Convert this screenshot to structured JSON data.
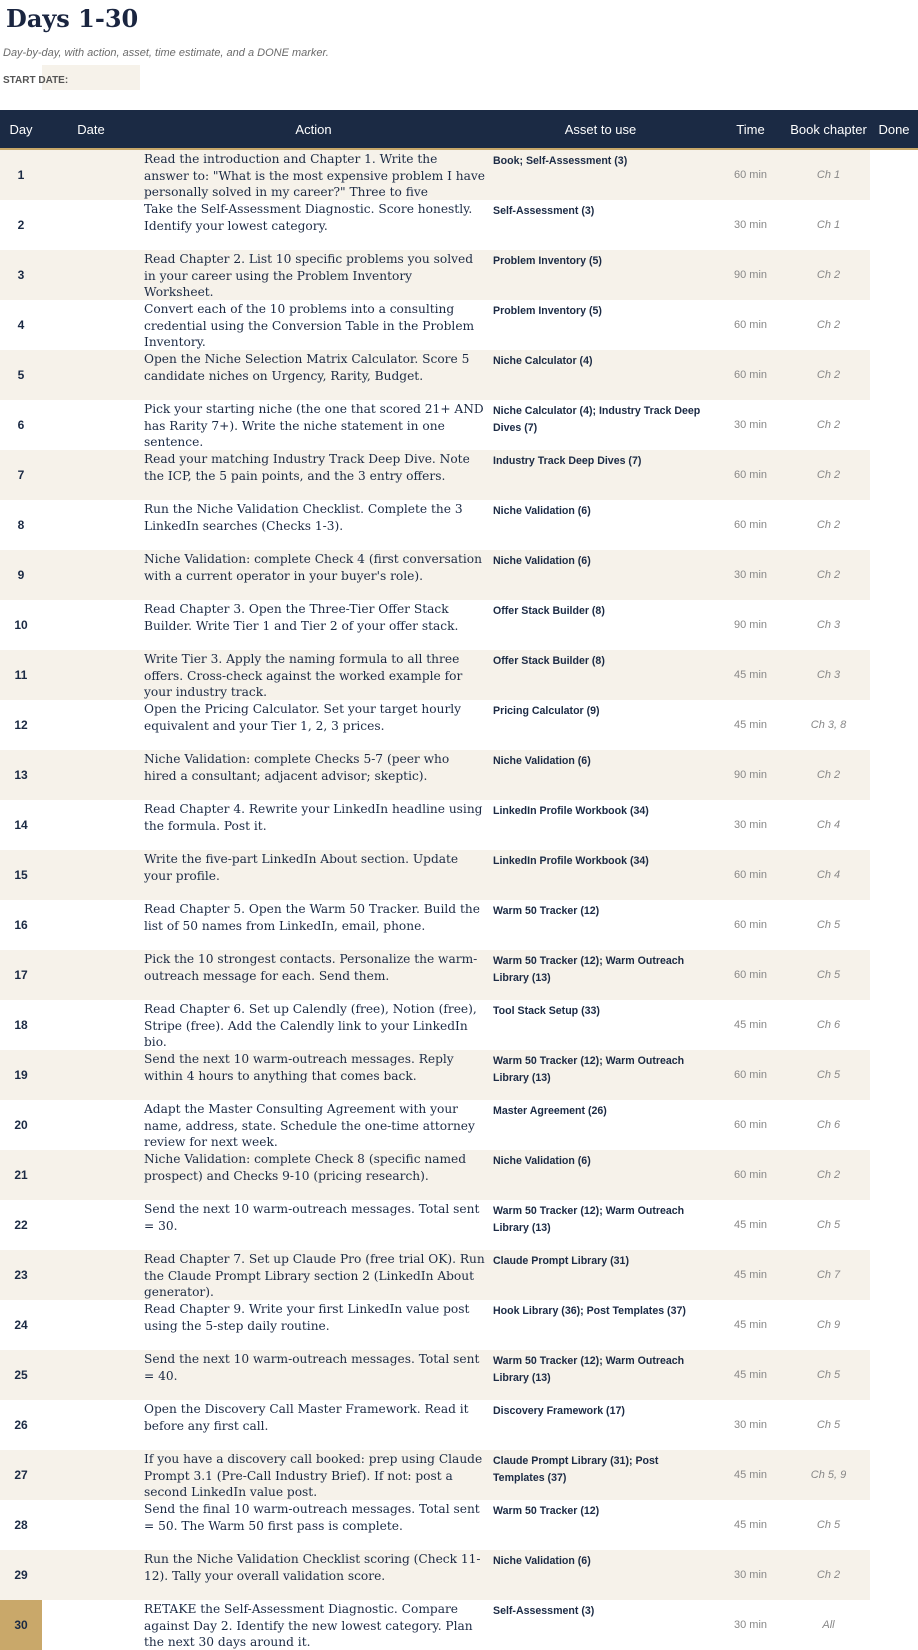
{
  "title": "Days 1-30",
  "subtitle": "Day-by-day, with action, asset, time estimate, and a DONE marker.",
  "start_date_label": "START DATE:",
  "start_date_value": "",
  "columns": [
    "Day",
    "Date",
    "Action",
    "Asset to use",
    "Time",
    "Book chapter",
    "Done"
  ],
  "highlight_color": "#c9a86a",
  "header_color": "#1b2a44",
  "rows": [
    {
      "day": "1",
      "action": "Read the introduction and Chapter 1. Write the answer to: \"What is the most expensive problem I have personally solved in my career?\" Three to five",
      "asset": "Book; Self-Assessment (3)",
      "time": "60 min",
      "chapter": "Ch 1"
    },
    {
      "day": "2",
      "action": "Take the Self-Assessment Diagnostic. Score honestly. Identify your lowest category.",
      "asset": "Self-Assessment (3)",
      "time": "30 min",
      "chapter": "Ch 1"
    },
    {
      "day": "3",
      "action": "Read Chapter 2. List 10 specific problems you solved in your career using the Problem Inventory Worksheet.",
      "asset": "Problem Inventory (5)",
      "time": "90 min",
      "chapter": "Ch 2"
    },
    {
      "day": "4",
      "action": "Convert each of the 10 problems into a consulting credential using the Conversion Table in the Problem Inventory.",
      "asset": "Problem Inventory (5)",
      "time": "60 min",
      "chapter": "Ch 2"
    },
    {
      "day": "5",
      "action": "Open the Niche Selection Matrix Calculator. Score 5 candidate niches on Urgency, Rarity, Budget.",
      "asset": "Niche Calculator (4)",
      "time": "60 min",
      "chapter": "Ch 2"
    },
    {
      "day": "6",
      "action": "Pick your starting niche (the one that scored 21+ AND has Rarity 7+). Write the niche statement in one sentence.",
      "asset": "Niche Calculator (4); Industry Track Deep Dives (7)",
      "time": "30 min",
      "chapter": "Ch 2"
    },
    {
      "day": "7",
      "action": "Read your matching Industry Track Deep Dive. Note the ICP, the 5 pain points, and the 3 entry offers.",
      "asset": "Industry Track Deep Dives (7)",
      "time": "60 min",
      "chapter": "Ch 2"
    },
    {
      "day": "8",
      "action": "Run the Niche Validation Checklist. Complete the 3 LinkedIn searches (Checks 1-3).",
      "asset": "Niche Validation (6)",
      "time": "60 min",
      "chapter": "Ch 2"
    },
    {
      "day": "9",
      "action": "Niche Validation: complete Check 4 (first conversation with a current operator in your buyer's role).",
      "asset": "Niche Validation (6)",
      "time": "30 min",
      "chapter": "Ch 2"
    },
    {
      "day": "10",
      "action": "Read Chapter 3. Open the Three-Tier Offer Stack Builder. Write Tier 1 and Tier 2 of your offer stack.",
      "asset": "Offer Stack Builder (8)",
      "time": "90 min",
      "chapter": "Ch 3"
    },
    {
      "day": "11",
      "action": "Write Tier 3. Apply the naming formula to all three offers. Cross-check against the worked example for your industry track.",
      "asset": "Offer Stack Builder (8)",
      "time": "45 min",
      "chapter": "Ch 3"
    },
    {
      "day": "12",
      "action": "Open the Pricing Calculator. Set your target hourly equivalent and your Tier 1, 2, 3 prices.",
      "asset": "Pricing Calculator (9)",
      "time": "45 min",
      "chapter": "Ch 3, 8"
    },
    {
      "day": "13",
      "action": "Niche Validation: complete Checks 5-7 (peer who hired a consultant; adjacent advisor; skeptic).",
      "asset": "Niche Validation (6)",
      "time": "90 min",
      "chapter": "Ch 2"
    },
    {
      "day": "14",
      "action": "Read Chapter 4. Rewrite your LinkedIn headline using the formula. Post it.",
      "asset": "LinkedIn Profile Workbook (34)",
      "time": "30 min",
      "chapter": "Ch 4"
    },
    {
      "day": "15",
      "action": "Write the five-part LinkedIn About section. Update your profile.",
      "asset": "LinkedIn Profile Workbook (34)",
      "time": "60 min",
      "chapter": "Ch 4"
    },
    {
      "day": "16",
      "action": "Read Chapter 5. Open the Warm 50 Tracker. Build the list of 50 names from LinkedIn, email, phone.",
      "asset": "Warm 50 Tracker (12)",
      "time": "60 min",
      "chapter": "Ch 5"
    },
    {
      "day": "17",
      "action": "Pick the 10 strongest contacts. Personalize the warm-outreach message for each. Send them.",
      "asset": "Warm 50 Tracker (12); Warm Outreach Library (13)",
      "time": "60 min",
      "chapter": "Ch 5"
    },
    {
      "day": "18",
      "action": "Read Chapter 6. Set up Calendly (free), Notion (free), Stripe (free). Add the Calendly link to your LinkedIn bio.",
      "asset": "Tool Stack Setup (33)",
      "time": "45 min",
      "chapter": "Ch 6"
    },
    {
      "day": "19",
      "action": "Send the next 10 warm-outreach messages. Reply within 4 hours to anything that comes back.",
      "asset": "Warm 50 Tracker (12); Warm Outreach Library (13)",
      "time": "60 min",
      "chapter": "Ch 5"
    },
    {
      "day": "20",
      "action": "Adapt the Master Consulting Agreement with your name, address, state. Schedule the one-time attorney review for next week.",
      "asset": "Master Agreement (26)",
      "time": "60 min",
      "chapter": "Ch 6"
    },
    {
      "day": "21",
      "action": "Niche Validation: complete Check 8 (specific named prospect) and Checks 9-10 (pricing research).",
      "asset": "Niche Validation (6)",
      "time": "60 min",
      "chapter": "Ch 2"
    },
    {
      "day": "22",
      "action": "Send the next 10 warm-outreach messages. Total sent = 30.",
      "asset": "Warm 50 Tracker (12); Warm Outreach Library (13)",
      "time": "45 min",
      "chapter": "Ch 5"
    },
    {
      "day": "23",
      "action": "Read Chapter 7. Set up Claude Pro (free trial OK). Run the Claude Prompt Library section 2 (LinkedIn About generator).",
      "asset": "Claude Prompt Library (31)",
      "time": "45 min",
      "chapter": "Ch 7"
    },
    {
      "day": "24",
      "action": "Read Chapter 9. Write your first LinkedIn value post using the 5-step daily routine.",
      "asset": "Hook Library (36); Post Templates (37)",
      "time": "45 min",
      "chapter": "Ch 9"
    },
    {
      "day": "25",
      "action": "Send the next 10 warm-outreach messages. Total sent = 40.",
      "asset": "Warm 50 Tracker (12); Warm Outreach Library (13)",
      "time": "45 min",
      "chapter": "Ch 5"
    },
    {
      "day": "26",
      "action": "Open the Discovery Call Master Framework. Read it before any first call.",
      "asset": "Discovery Framework (17)",
      "time": "30 min",
      "chapter": "Ch 5"
    },
    {
      "day": "27",
      "action": "If you have a discovery call booked: prep using Claude Prompt 3.1 (Pre-Call Industry Brief). If not: post a second LinkedIn value post.",
      "asset": "Claude Prompt Library (31); Post Templates (37)",
      "time": "45 min",
      "chapter": "Ch 5, 9"
    },
    {
      "day": "28",
      "action": "Send the final 10 warm-outreach messages. Total sent = 50. The Warm 50 first pass is complete.",
      "asset": "Warm 50 Tracker (12)",
      "time": "45 min",
      "chapter": "Ch 5"
    },
    {
      "day": "29",
      "action": "Run the Niche Validation Checklist scoring (Check 11-12). Tally your overall validation score.",
      "asset": "Niche Validation (6)",
      "time": "30 min",
      "chapter": "Ch 2"
    },
    {
      "day": "30",
      "action": "RETAKE the Self-Assessment Diagnostic. Compare against Day 2. Identify the new lowest category. Plan the next 30 days around it.",
      "asset": "Self-Assessment (3)",
      "time": "30 min",
      "chapter": "All",
      "highlight": true
    }
  ]
}
